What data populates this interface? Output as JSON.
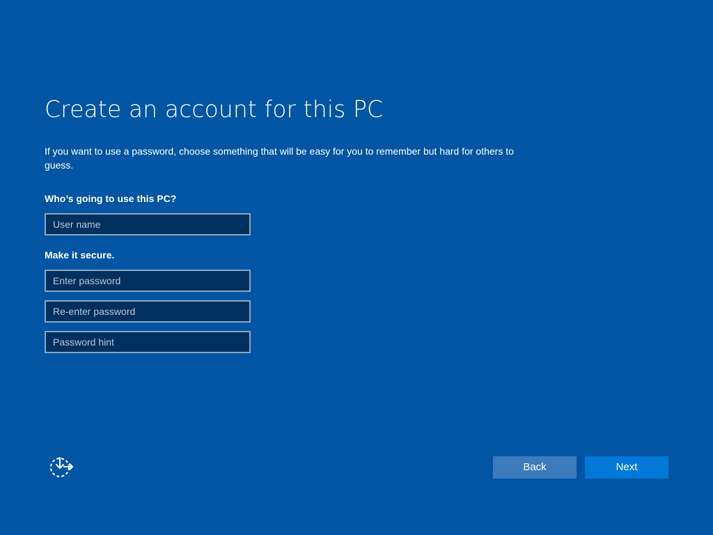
{
  "page": {
    "title": "Create an account for this PC",
    "description": "If you want to use a password, choose something that will be easy for you to remember but hard for others to guess."
  },
  "user_section": {
    "label": "Who’s going to use this PC?",
    "username_placeholder": "User name",
    "username_value": ""
  },
  "security_section": {
    "label": "Make it secure.",
    "password_placeholder": "Enter password",
    "password_value": "",
    "reenter_placeholder": "Re-enter password",
    "reenter_value": "",
    "hint_placeholder": "Password hint",
    "hint_value": ""
  },
  "footer": {
    "accessibility_icon": "ease-of-access-icon",
    "back_label": "Back",
    "next_label": "Next"
  },
  "colors": {
    "background": "#0155a3",
    "field_background": "#00305e",
    "field_border": "#8ba6c0",
    "back_button": "#3d7bbf",
    "next_button": "#0078d7"
  }
}
